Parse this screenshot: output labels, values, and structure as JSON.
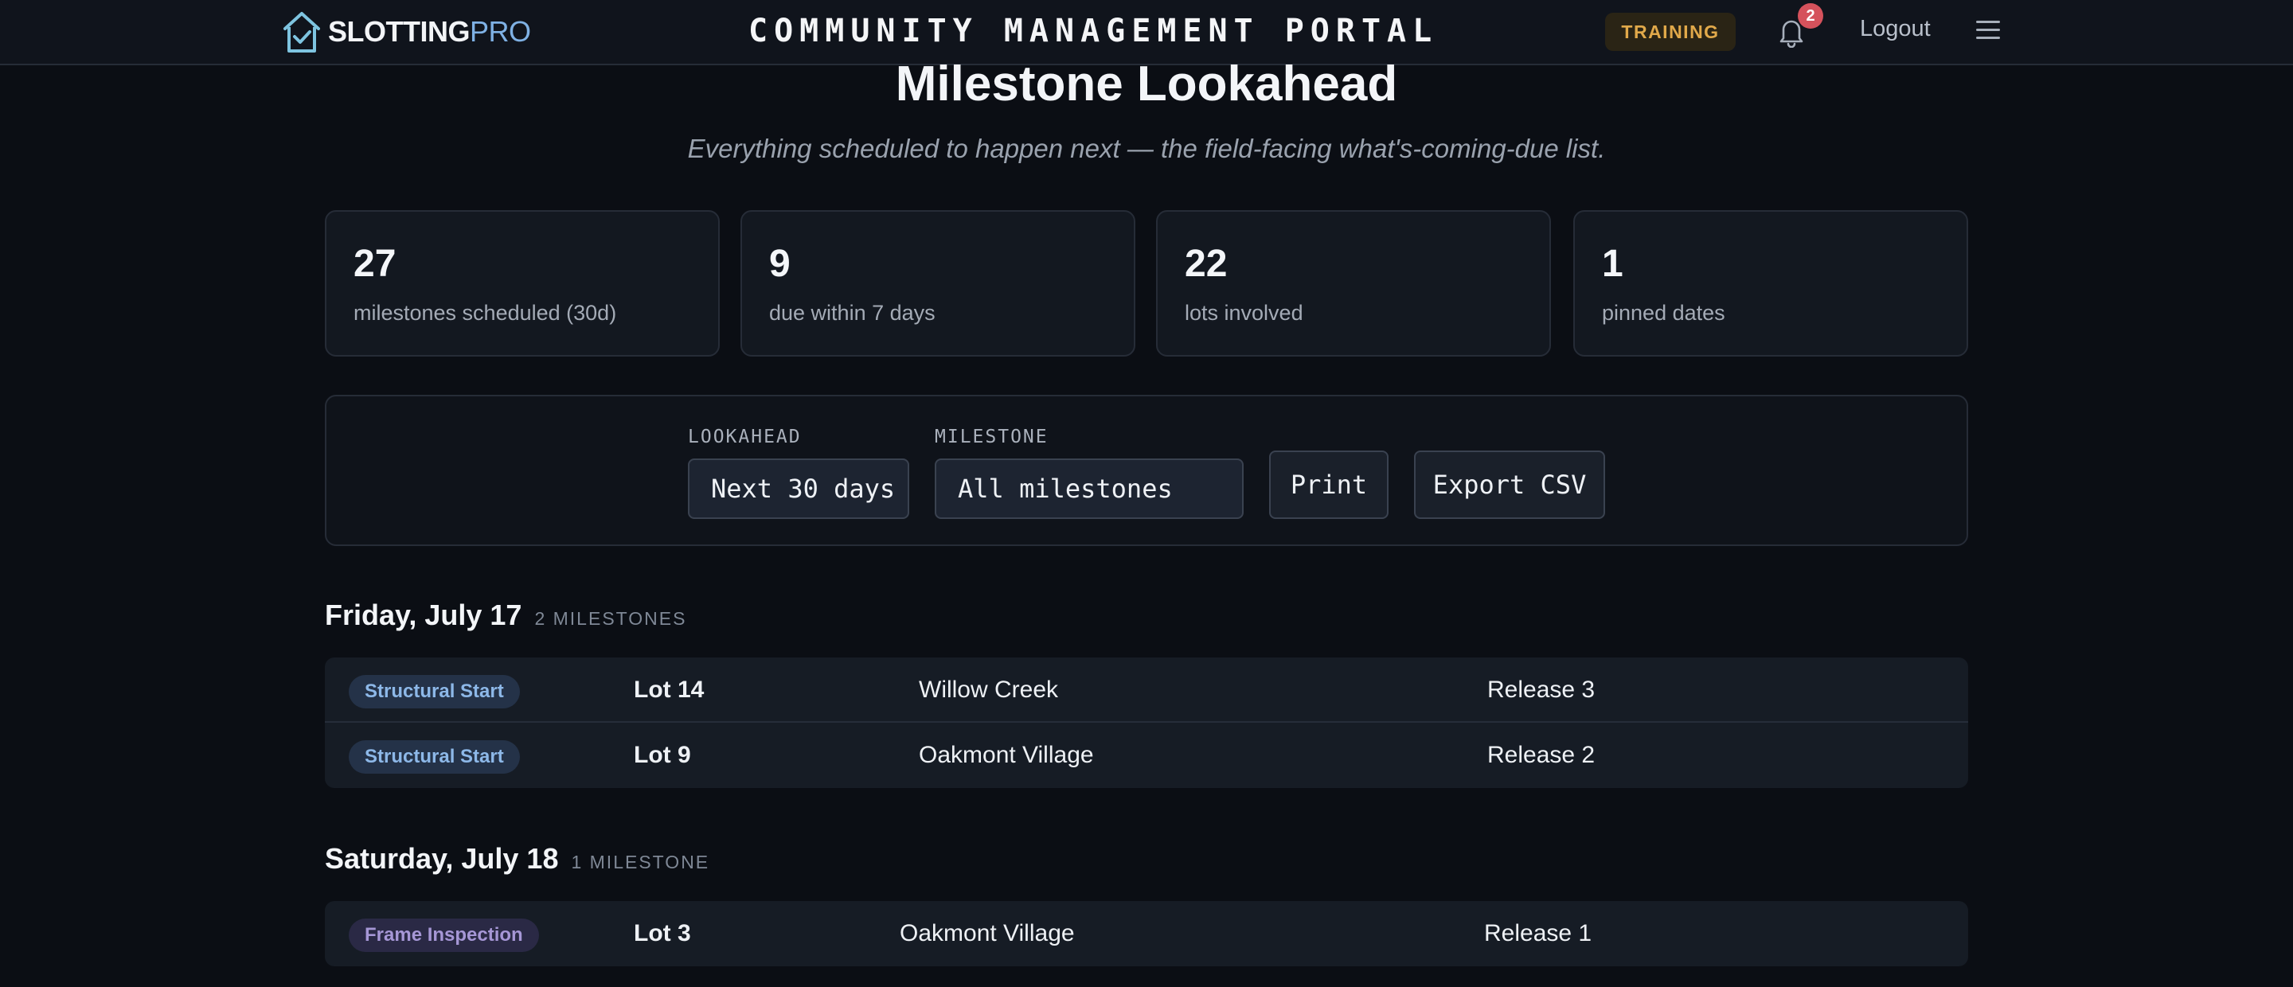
{
  "header": {
    "brand_strong": "SLOTTING",
    "brand_light": "PRO",
    "portal_title": "COMMUNITY MANAGEMENT PORTAL",
    "training_badge": "TRAINING",
    "notification_count": "2",
    "logout_label": "Logout",
    "icons": [
      "house-check-logo-icon",
      "bell-icon",
      "hamburger-menu-icon"
    ]
  },
  "page": {
    "title": "Milestone Lookahead",
    "subtitle": "Everything scheduled to happen next — the field-facing what's-coming-due list."
  },
  "stats": [
    {
      "value": "27",
      "label": "milestones scheduled (30d)"
    },
    {
      "value": "9",
      "label": "due within 7 days"
    },
    {
      "value": "22",
      "label": "lots involved"
    },
    {
      "value": "1",
      "label": "pinned dates"
    }
  ],
  "filters": {
    "lookahead_label": "LOOKAHEAD",
    "lookahead_value": "Next 30 days",
    "milestone_label": "MILESTONE",
    "milestone_value": "All milestones",
    "print_label": "Print",
    "export_label": "Export CSV"
  },
  "days": [
    {
      "title": "Friday, July 17",
      "count": "2 MILESTONES",
      "rows": [
        {
          "milestone": "Structural Start",
          "kind": "structural",
          "lot": "Lot 14",
          "community": "Willow Creek",
          "release": "Release 3"
        },
        {
          "milestone": "Structural Start",
          "kind": "structural",
          "lot": "Lot 9",
          "community": "Oakmont Village",
          "release": "Release 2"
        }
      ]
    },
    {
      "title": "Saturday, July 18",
      "count": "1 MILESTONE",
      "rows": [
        {
          "milestone": "Frame Inspection",
          "kind": "frame",
          "lot": "Lot 3",
          "community": "Oakmont Village",
          "release": "Release 1"
        }
      ]
    }
  ],
  "colors": {
    "background": "#0b0e14",
    "accent": "#7fb1e4",
    "training": "#e1a94a",
    "notification": "#d5525c",
    "structural_pill": "#8db8e8",
    "frame_pill": "#a697d6"
  }
}
